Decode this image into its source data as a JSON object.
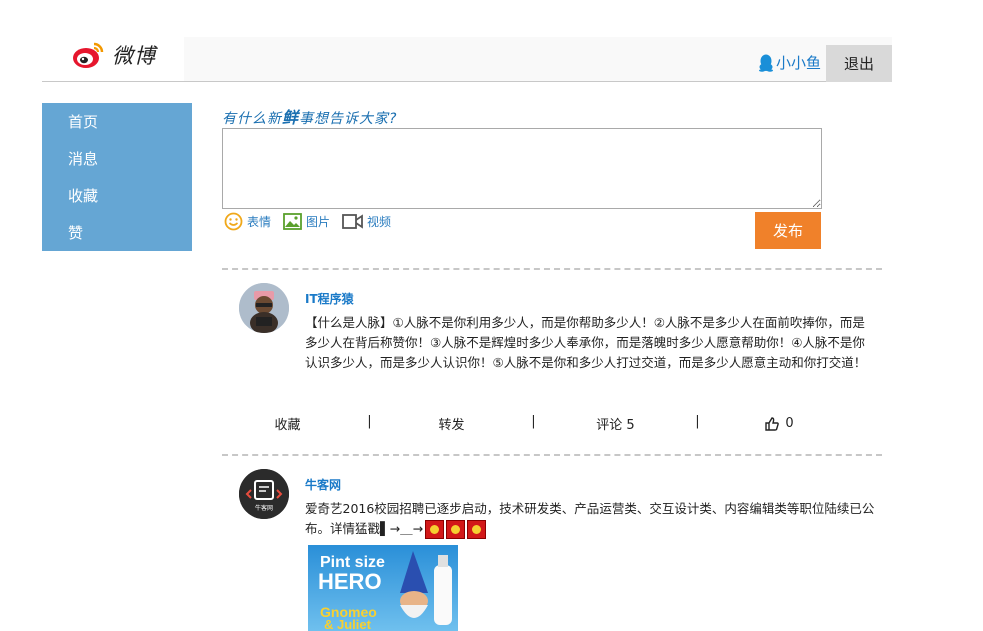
{
  "header": {
    "logo_text": "微博",
    "username": "小小鱼",
    "logout_label": "退出"
  },
  "sidebar": {
    "items": [
      {
        "label": "首页"
      },
      {
        "label": "消息"
      },
      {
        "label": "收藏"
      },
      {
        "label": "赞"
      }
    ]
  },
  "composer": {
    "prompt_pre": "有什么新",
    "prompt_emph": "鲜",
    "prompt_post": "事想告诉大家?",
    "input_value": "",
    "tools": [
      {
        "label": "表情",
        "icon": "smile-icon"
      },
      {
        "label": "图片",
        "icon": "image-icon"
      },
      {
        "label": "视频",
        "icon": "video-icon"
      }
    ],
    "publish_label": "发布"
  },
  "posts": [
    {
      "author": "IT程序猿",
      "text": "【什么是人脉】①人脉不是你利用多少人，而是你帮助多少人！②人脉不是多少人在面前吹捧你，而是多少人在背后称赞你！③人脉不是辉煌时多少人奉承你，而是落魄时多少人愿意帮助你！④人脉不是你认识多少人，而是多少人认识你！⑤人脉不是你和多少人打过交道，而是多少人愿意主动和你打交道！",
      "actions": {
        "favorite": "收藏",
        "forward": "转发",
        "comment": "评论 5",
        "like_count": "0",
        "separator": "|"
      }
    },
    {
      "author": "牛客网",
      "text": "爱奇艺2016校园招聘已逐步启动，技术研发类、产品运营类、交互设计类、内容编辑类等职位陆续已公布。详情猛戳▌→＿→",
      "avatar_label": "牛客网",
      "image_title_1": "Pint size",
      "image_title_2": "HERO",
      "image_title_3": "Gnomeo",
      "image_title_4": "& Juliet"
    }
  ],
  "colors": {
    "accent": "#1a7ac8",
    "sidebar_bg": "#65a6d4",
    "publish_bg": "#f0812a"
  }
}
